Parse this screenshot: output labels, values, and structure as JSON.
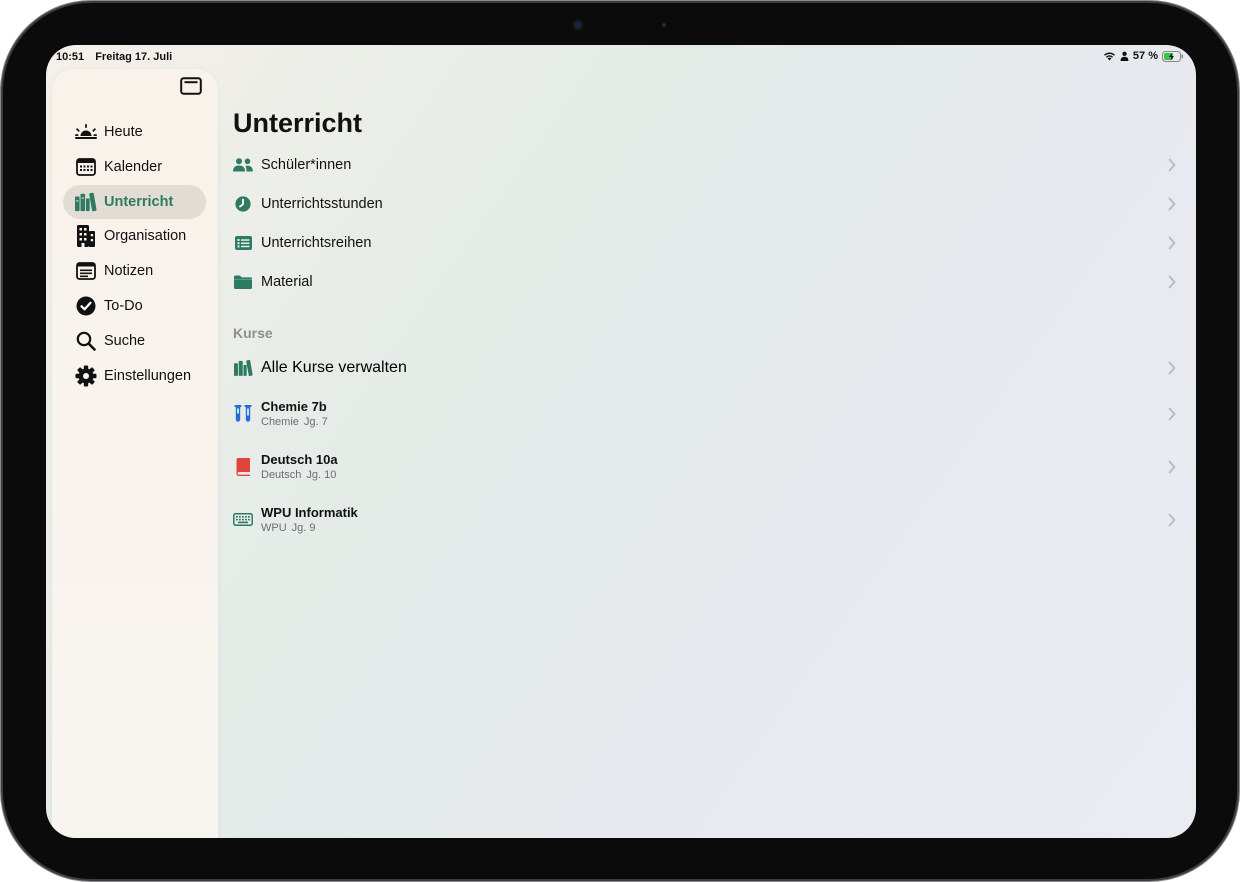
{
  "status_bar": {
    "time": "10:51",
    "date": "Freitag 17. Juli",
    "battery": "57 %"
  },
  "colors": {
    "accent": "#2e7a63",
    "chemistry": "#1f6ed4",
    "german": "#e0453b"
  },
  "sidebar": {
    "items": [
      {
        "label": "Heute",
        "icon": "sunrise-icon",
        "active": false
      },
      {
        "label": "Kalender",
        "icon": "calendar-icon",
        "active": false
      },
      {
        "label": "Unterricht",
        "icon": "books-icon",
        "active": true
      },
      {
        "label": "Organisation",
        "icon": "building-icon",
        "active": false
      },
      {
        "label": "Notizen",
        "icon": "note-icon",
        "active": false
      },
      {
        "label": "To-Do",
        "icon": "checkmark-circle-icon",
        "active": false
      },
      {
        "label": "Suche",
        "icon": "search-icon",
        "active": false
      },
      {
        "label": "Einstellungen",
        "icon": "gear-icon",
        "active": false
      }
    ]
  },
  "main": {
    "title": "Unterricht",
    "rows": [
      {
        "label": "Schüler*innen",
        "icon": "people-icon"
      },
      {
        "label": "Unterrichtsstunden",
        "icon": "clock-icon"
      },
      {
        "label": "Unterrichtsreihen",
        "icon": "list-icon"
      },
      {
        "label": "Material",
        "icon": "folder-icon"
      }
    ],
    "courses_header": "Kurse",
    "manage_label": "Alle Kurse verwalten",
    "courses": [
      {
        "title": "Chemie 7b",
        "subject": "Chemie",
        "grade": "Jg. 7",
        "icon": "test-tubes-icon"
      },
      {
        "title": "Deutsch 10a",
        "subject": "Deutsch",
        "grade": "Jg. 10",
        "icon": "book-icon"
      },
      {
        "title": "WPU Informatik",
        "subject": "WPU",
        "grade": "Jg. 9",
        "icon": "keyboard-icon"
      }
    ]
  }
}
